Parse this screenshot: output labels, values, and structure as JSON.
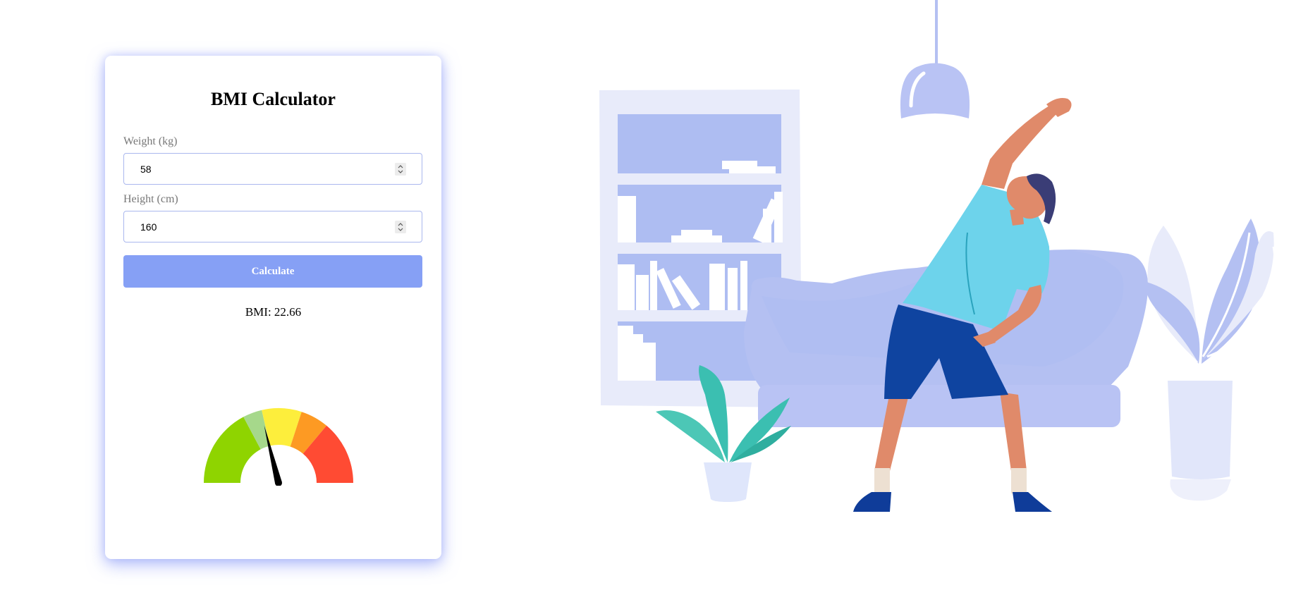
{
  "calculator": {
    "title": "BMI Calculator",
    "weight": {
      "label": "Weight (kg)",
      "value": "58"
    },
    "height": {
      "label": "Height (cm)",
      "value": "160"
    },
    "calculate_label": "Calculate",
    "result_prefix": "BMI:",
    "result_value": "22.66",
    "result_text": "BMI: 22.66"
  },
  "gauge": {
    "bmi": 22.66,
    "segment_colors": [
      "#8fd400",
      "#a6d88b",
      "#fdee3c",
      "#fd9a23",
      "#ff4b33"
    ],
    "needle_color": "#000000"
  },
  "colors": {
    "accent": "#86a0f5",
    "illustration_primary": "#b4c0f2"
  }
}
